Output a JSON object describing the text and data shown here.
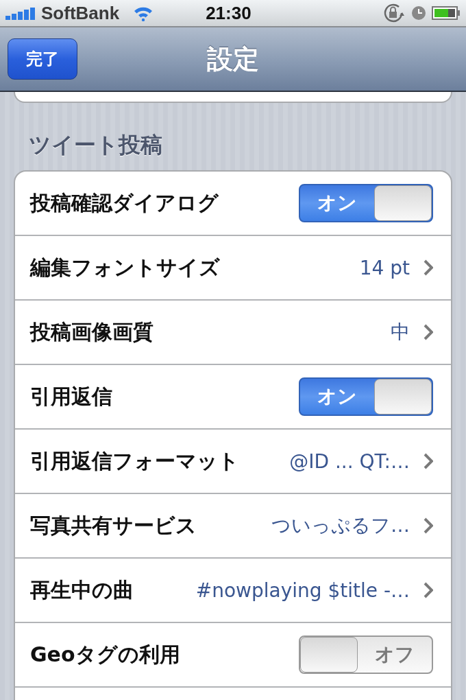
{
  "status_bar": {
    "carrier": "SoftBank",
    "time": "21:30"
  },
  "nav_bar": {
    "title": "設定",
    "done_button": "完了"
  },
  "section": {
    "header": "ツイート投稿",
    "rows": [
      {
        "kind": "toggle",
        "label": "投稿確認ダイアログ",
        "on": true,
        "switch_text": "オン"
      },
      {
        "kind": "disclosure",
        "label": "編集フォントサイズ",
        "value": "14 pt"
      },
      {
        "kind": "disclosure",
        "label": "投稿画像画質",
        "value": "中"
      },
      {
        "kind": "toggle",
        "label": "引用返信",
        "on": true,
        "switch_text": "オン"
      },
      {
        "kind": "disclosure",
        "label": "引用返信フォーマット",
        "value": "@ID ... QT:…"
      },
      {
        "kind": "disclosure",
        "label": "写真共有サービス",
        "value": "ついっぷるフ…"
      },
      {
        "kind": "disclosure",
        "label": "再生中の曲",
        "value": "#nowplaying $title -…"
      },
      {
        "kind": "toggle",
        "label": "Geoタグの利用",
        "on": false,
        "switch_text": "オフ"
      }
    ]
  }
}
